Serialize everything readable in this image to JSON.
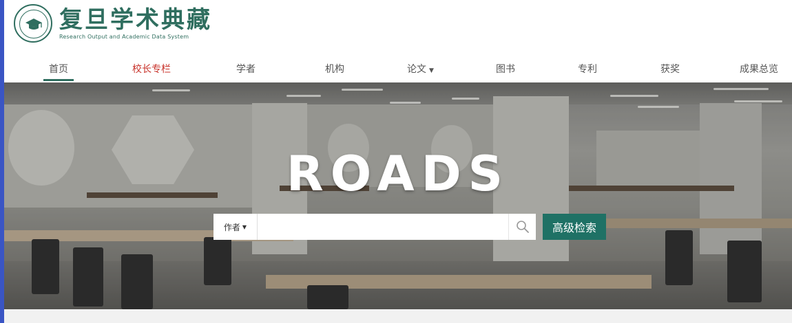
{
  "logo": {
    "title": "复旦学术典藏",
    "subtitle": "Research Output and Academic Data System"
  },
  "nav": {
    "items": [
      {
        "label": "首页"
      },
      {
        "label": "校长专栏"
      },
      {
        "label": "学者"
      },
      {
        "label": "机构"
      },
      {
        "label": "论文"
      },
      {
        "label": "图书"
      },
      {
        "label": "专利"
      },
      {
        "label": "获奖"
      },
      {
        "label": "成果总览"
      }
    ],
    "active_item": "首页",
    "highlighted_item": "校长专栏"
  },
  "hero": {
    "brand": "ROADS"
  },
  "search": {
    "field_selected": "作者",
    "query": "",
    "advanced_label": "高级检索"
  },
  "colors": {
    "brand_green": "#2f6e5f",
    "button_green": "#1f7165",
    "highlight_red": "#c8322a",
    "frame_blue": "#3a55c4"
  },
  "icons": {
    "search": "search-icon",
    "dropdown": "chevron-down-icon",
    "logo": "university-seal-icon"
  }
}
